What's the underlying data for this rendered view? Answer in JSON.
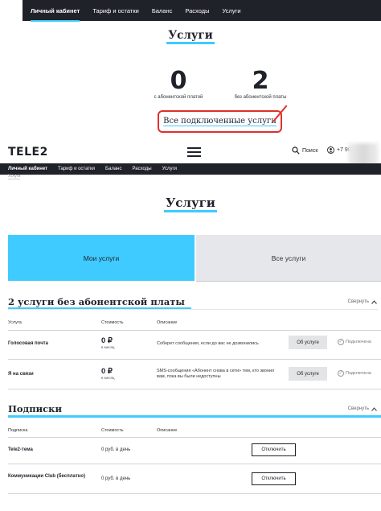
{
  "crop": {
    "nav": [
      "Личный кабинет",
      "Тариф и остатки",
      "Баланс",
      "Расходы",
      "Услуги"
    ],
    "title": "Услуги",
    "stats": [
      {
        "value": "0",
        "label": "с абонентской платой"
      },
      {
        "value": "2",
        "label": "без абонентской платы"
      }
    ],
    "highlight_link": "Все подключенные услуги",
    "highlight_color": "#e0302a"
  },
  "header": {
    "logo": "TELE2",
    "search_label": "Поиск",
    "phone_prefix": "+7 90"
  },
  "nav": [
    "Личный кабинет",
    "Тариф и остатки",
    "Баланс",
    "Расходы",
    "Услуги"
  ],
  "breadcrumb": "Услуги",
  "page_title": "Услуги",
  "tabs": {
    "my": "Мои услуги",
    "all": "Все услуги"
  },
  "free_section": {
    "title": "2 услуги без абонентской платы",
    "collapse": "Свернуть",
    "headers": {
      "service": "Услуга",
      "cost": "Стоимость",
      "desc": "Описание"
    },
    "rows": [
      {
        "name": "Голосовая почта",
        "price": "0 ₽",
        "period": "в месяц",
        "desc": "Соберет сообщения, если до вас не дозвонились",
        "button": "Об услуге",
        "status": "Подключена"
      },
      {
        "name": "Я на связи",
        "price": "0 ₽",
        "period": "в месяц",
        "desc": "SMS-сообщения «Абонент снова в сети» тем, кто звонил вам, пока вы были недоступны",
        "button": "Об услуге",
        "status": "Подключена"
      }
    ]
  },
  "subs_section": {
    "title": "Подписки",
    "collapse": "Свернуть",
    "headers": {
      "service": "Подписка",
      "cost": "Стоимость",
      "desc": "Описание"
    },
    "rows": [
      {
        "name": "Tele2-тема",
        "price": "0 руб. в день",
        "button": "Отключить"
      },
      {
        "name": "Коммуникации Club (бесплатно)",
        "price": "0 руб. в день",
        "button": "Отключить"
      }
    ]
  },
  "colors": {
    "accent": "#3fcbff",
    "dark": "#1f2229"
  }
}
